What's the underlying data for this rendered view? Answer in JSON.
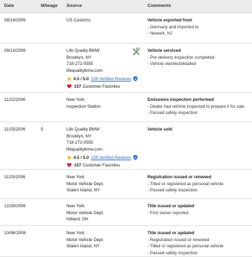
{
  "headers": {
    "date": "Date",
    "mileage": "Mileage",
    "source": "Source",
    "comments": "Comments"
  },
  "rows": [
    {
      "date": "08/14/2006",
      "mileage": "",
      "source": [
        "US Customs"
      ],
      "comment_title": "Vehicle exported from",
      "comment_lines": [
        "- Germany and imported to",
        "- Newark, NJ"
      ]
    },
    {
      "date": "09/13/2006",
      "mileage": "",
      "source": [
        "Life Quality BMW",
        "Brooklyn, NY",
        "718-272-0555",
        "lifequalitybmw.com"
      ],
      "rating": {
        "score": "4.5 / 5.0",
        "reviews": "228 Verified Reviews"
      },
      "favorites": {
        "count": "157",
        "label": "Customer Favorites"
      },
      "service_icon": "wrench-screwdriver-icon",
      "comment_title": "Vehicle serviced",
      "comment_lines": [
        "- Pre-delivery inspection completed",
        "- Vehicle washed/detailed"
      ]
    },
    {
      "date": "11/22/2006",
      "mileage": "",
      "source": [
        "New York",
        "Inspection Station"
      ],
      "comment_title": "Emissions inspection performed",
      "comment_lines": [
        "- Dealer had vehicle inspected to prepare it for sale",
        "- Passed safety inspection"
      ]
    },
    {
      "date": "11/25/2006",
      "mileage": "5",
      "source": [
        "Life Quality BMW",
        "Brooklyn, NY",
        "718-272-0555",
        "lifequalitybmw.com"
      ],
      "rating": {
        "score": "4.5 / 5.0",
        "reviews": "228 Verified Reviews"
      },
      "favorites": {
        "count": "157",
        "label": "Customer Favorites"
      },
      "comment_title": "Vehicle sold",
      "comment_lines": []
    },
    {
      "date": "11/25/2006",
      "mileage": "",
      "source": [
        "New York",
        "Motor Vehicle Dept.",
        "Staten Island, NY"
      ],
      "comment_title": "Registration issued or renewed",
      "comment_lines": [
        "- Titled or registered as personal vehicle",
        "- Passed safety inspection"
      ]
    },
    {
      "date": "12/29/2006",
      "mileage": "",
      "source": [
        "New York",
        "Motor Vehicle Dept.",
        "Hilliard, OH"
      ],
      "comment_title": "Title issued or updated",
      "comment_lines": [
        "- First owner reported"
      ]
    },
    {
      "date": "10/06/2008",
      "mileage": "",
      "source": [
        "New York",
        "Motor Vehicle Dept.",
        "Staten Island, NY"
      ],
      "comment_title": "Title issued or updated",
      "comment_lines": [
        "- Registration issued or renewed",
        "- Titled or registered as personal vehicle",
        "- Passed safety inspection"
      ]
    }
  ],
  "colors": {
    "link": "#2a6cc4",
    "star": "#f5b400",
    "heart": "#d0234a",
    "header_bg": "#ececec"
  }
}
